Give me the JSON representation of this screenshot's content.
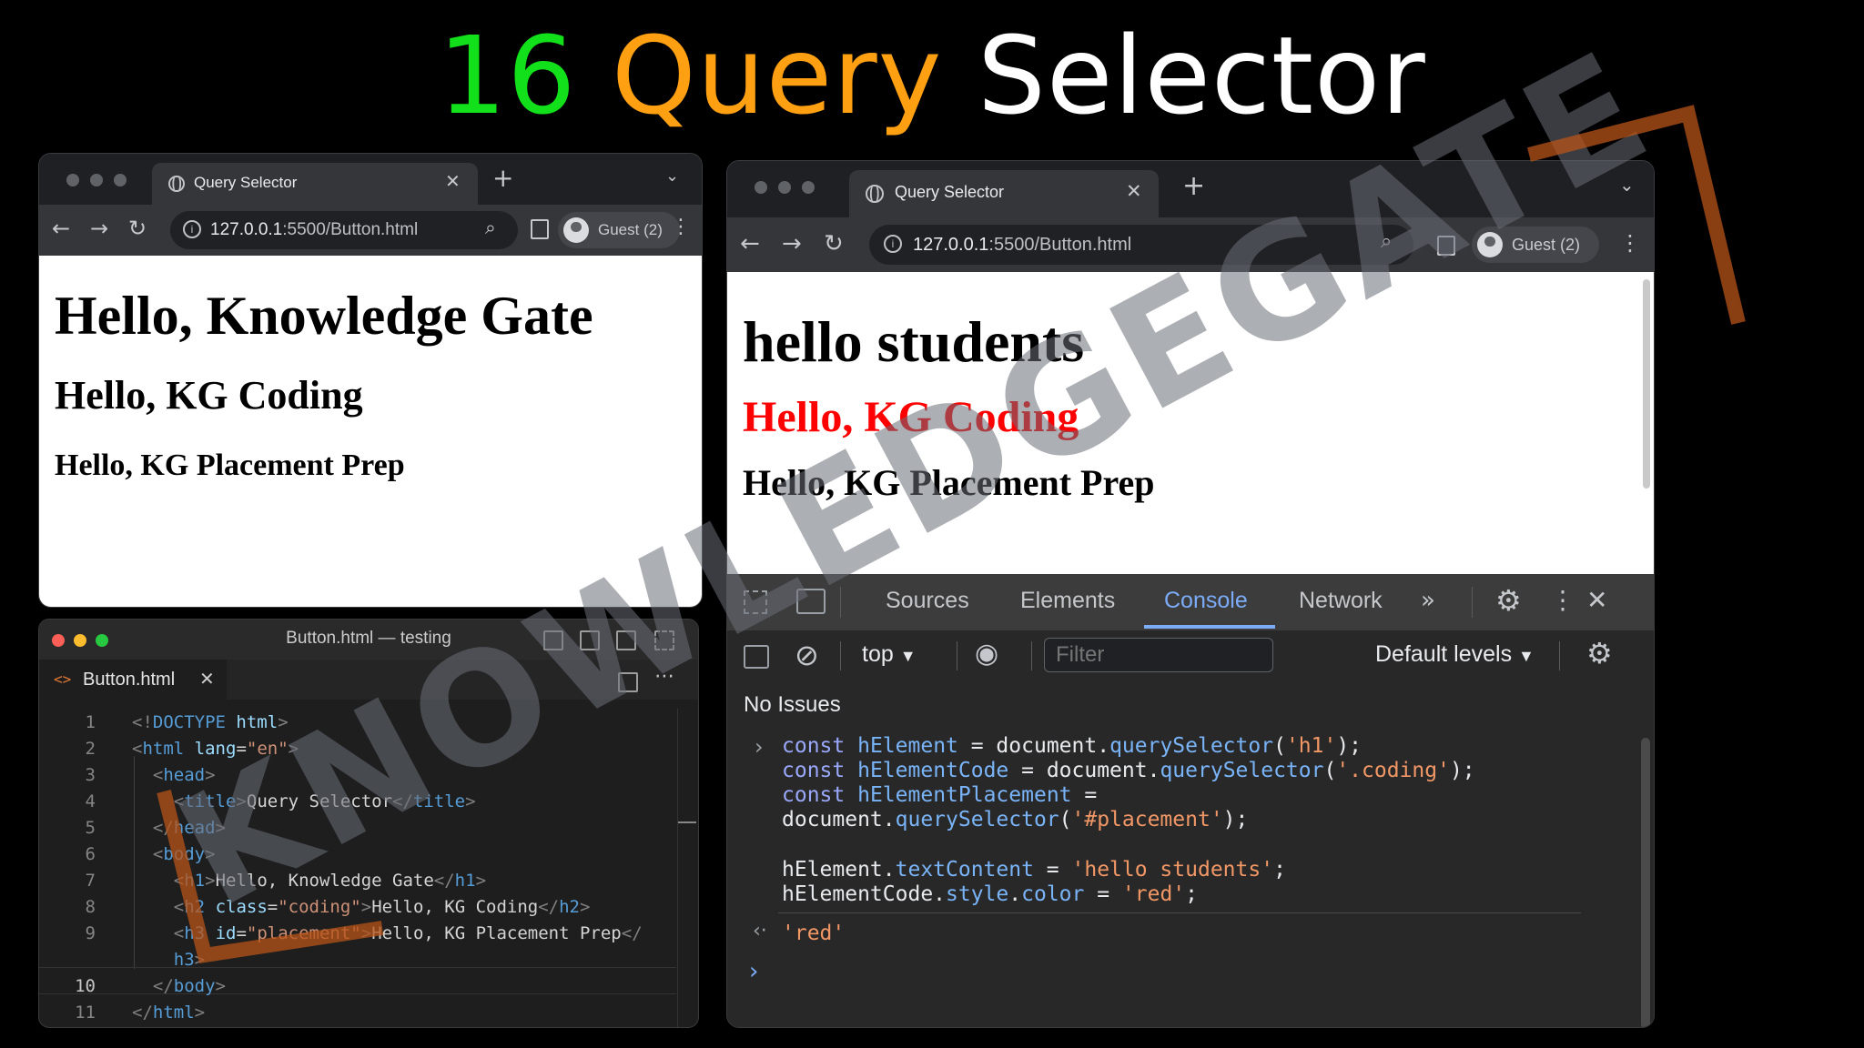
{
  "title": {
    "number": "16",
    "word1": "Query",
    "word2": "Selector"
  },
  "left_browser": {
    "tab_title": "Query Selector",
    "url_host": "127.0.0.1",
    "url_path": ":5500/Button.html",
    "profile": "Guest (2)",
    "headings": {
      "h1": "Hello, Knowledge Gate",
      "h2": "Hello, KG Coding",
      "h3": "Hello, KG Placement Prep"
    }
  },
  "right_browser": {
    "tab_title": "Query Selector",
    "url_host": "127.0.0.1",
    "url_path": ":5500/Button.html",
    "profile": "Guest (2)",
    "headings": {
      "h1": "hello students",
      "h2": "Hello, KG Coding",
      "h3": "Hello, KG Placement Prep"
    },
    "h2_color": "#ff0000",
    "devtools": {
      "tabs": [
        "Sources",
        "Elements",
        "Console",
        "Network"
      ],
      "active_tab": "Console",
      "context": "top",
      "filter_placeholder": "Filter",
      "levels": "Default levels",
      "issues": "No Issues",
      "result": "'red'"
    }
  },
  "editor": {
    "window_title": "Button.html — testing",
    "file_tab": "Button.html",
    "current_line": "10",
    "line_numbers": [
      "1",
      "2",
      "3",
      "4",
      "5",
      "6",
      "7",
      "8",
      "9",
      "",
      "10",
      "11"
    ]
  },
  "watermark": {
    "text": "KNOWLEDGEGATE"
  },
  "colors": {
    "green": "#12e01a",
    "orange": "#ffa012",
    "accent": "#7cacf8"
  }
}
